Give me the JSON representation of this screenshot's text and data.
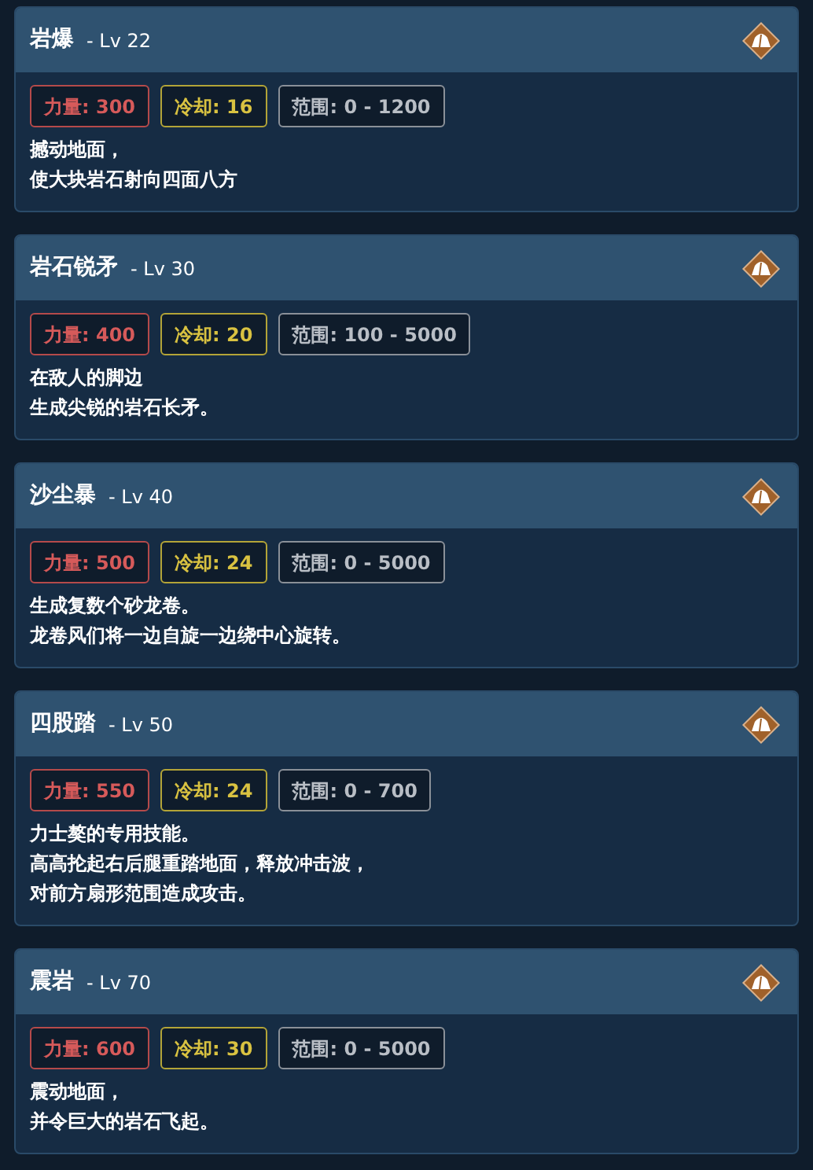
{
  "skills": [
    {
      "name": "岩爆",
      "level": "- Lv 22",
      "stats": [
        {
          "kind": "power",
          "text": "力量: 300"
        },
        {
          "kind": "cooldown",
          "text": "冷却: 16"
        },
        {
          "kind": "range",
          "text": "范围: 0 - 1200"
        }
      ],
      "description": [
        "撼动地面，",
        "使大块岩石射向四面八方"
      ]
    },
    {
      "name": "岩石锐矛",
      "level": "- Lv 30",
      "stats": [
        {
          "kind": "power",
          "text": "力量: 400"
        },
        {
          "kind": "cooldown",
          "text": "冷却: 20"
        },
        {
          "kind": "range",
          "text": "范围: 100 - 5000"
        }
      ],
      "description": [
        "在敌人的脚边",
        "生成尖锐的岩石长矛。"
      ]
    },
    {
      "name": "沙尘暴",
      "level": "- Lv 40",
      "stats": [
        {
          "kind": "power",
          "text": "力量: 500"
        },
        {
          "kind": "cooldown",
          "text": "冷却: 24"
        },
        {
          "kind": "range",
          "text": "范围: 0 - 5000"
        }
      ],
      "description": [
        "生成复数个砂龙卷。",
        "龙卷风们将一边自旋一边绕中心旋转。"
      ]
    },
    {
      "name": "四股踏",
      "level": "- Lv 50",
      "stats": [
        {
          "kind": "power",
          "text": "力量: 550"
        },
        {
          "kind": "cooldown",
          "text": "冷却: 24"
        },
        {
          "kind": "range",
          "text": "范围: 0 - 700"
        }
      ],
      "description": [
        "力士獒的专用技能。",
        "高高抡起右后腿重踏地面，释放冲击波，",
        "对前方扇形范围造成攻击。"
      ]
    },
    {
      "name": "震岩",
      "level": "- Lv 70",
      "stats": [
        {
          "kind": "power",
          "text": "力量: 600"
        },
        {
          "kind": "cooldown",
          "text": "冷却: 30"
        },
        {
          "kind": "range",
          "text": "范围: 0 - 5000"
        }
      ],
      "description": [
        "震动地面，",
        "并令巨大的岩石飞起。"
      ]
    }
  ]
}
